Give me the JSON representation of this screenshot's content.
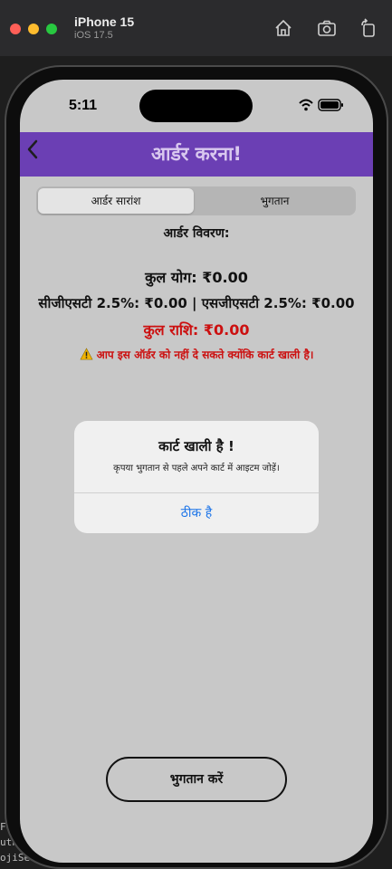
{
  "simulator": {
    "device_name": "iPhone 15",
    "os_version": "iOS 17.5",
    "icons": [
      "home-icon",
      "screenshot-icon",
      "rotate-icon"
    ]
  },
  "backdrop": {
    "code_lines": [
      "Fo",
      "uth",
      "ojiSea"
    ]
  },
  "status_bar": {
    "time": "5:11"
  },
  "nav": {
    "title": "आर्डर करना!"
  },
  "tabs": [
    {
      "label": "आर्डर सारांश",
      "selected": true
    },
    {
      "label": "भुगतान",
      "selected": false
    }
  ],
  "order": {
    "heading": "आर्डर विवरण:",
    "subtotal": "कुल योग: ₹0.00",
    "tax": "सीजीएसटी 2.5%: ₹0.00 | एसजीएसटी 2.5%: ₹0.00",
    "total": "कुल राशि: ₹0.00",
    "warning": "आप इस ऑर्डर को नहीं दे सकते क्योंकि कार्ट खाली है।"
  },
  "alert": {
    "title": "कार्ट खाली है !",
    "message": "कृपया भुगतान से पहले अपने कार्ट में आइटम जोड़ें।",
    "ok_label": "ठीक है"
  },
  "footer": {
    "pay_label": "भुगतान करें"
  },
  "colors": {
    "nav_bg": "#6b3fb4",
    "total_red": "#cc1010",
    "alert_link": "#1a73e8",
    "screen_bg": "#c8c8c8"
  }
}
